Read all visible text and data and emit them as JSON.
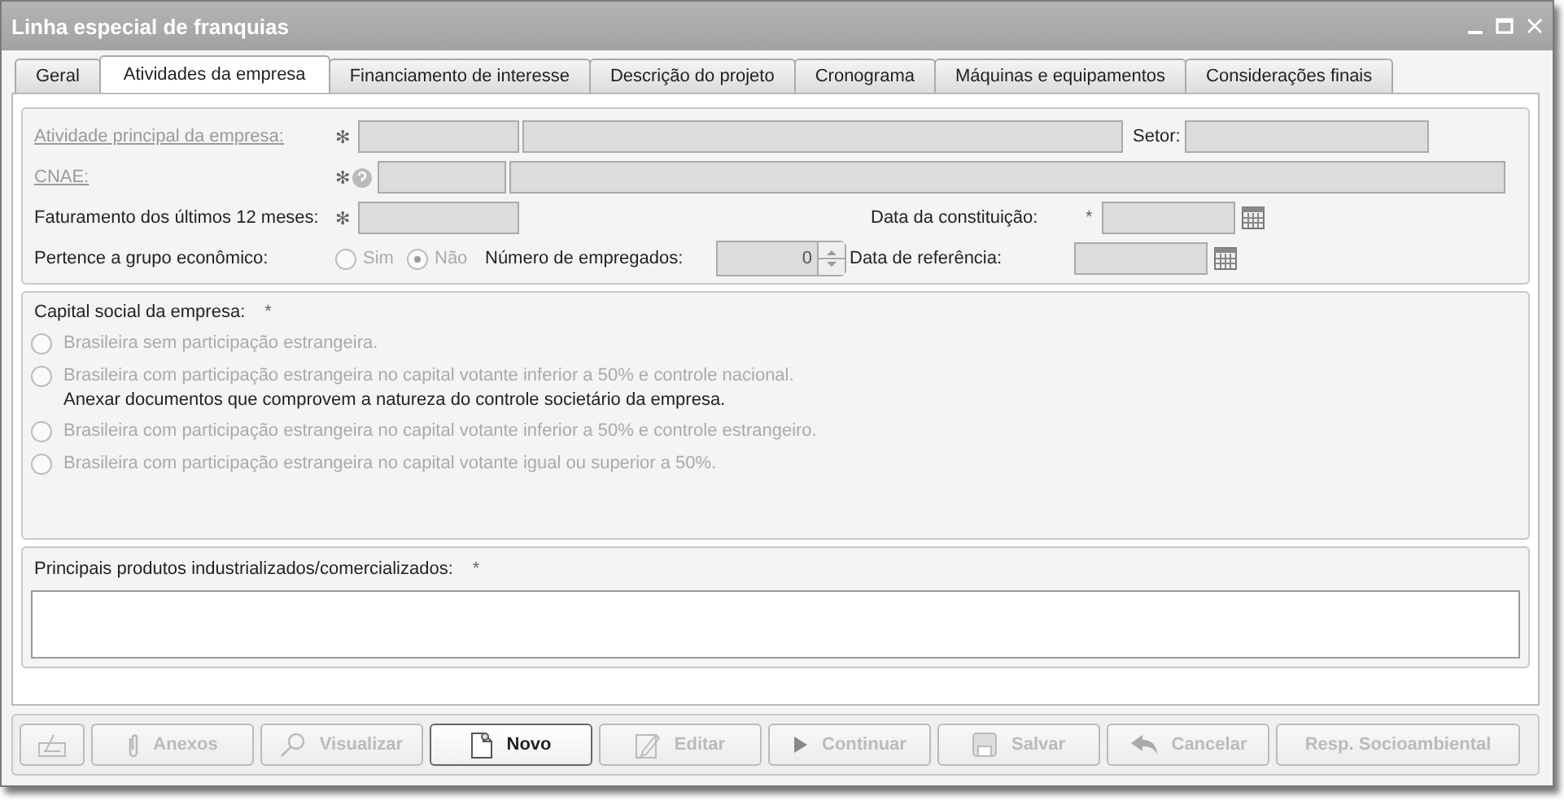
{
  "window": {
    "title": "Linha especial de franquias"
  },
  "tabs": [
    {
      "label": "Geral",
      "selected": false
    },
    {
      "label": "Atividades da empresa",
      "selected": true
    },
    {
      "label": "Financiamento de interesse",
      "selected": false
    },
    {
      "label": "Descrição do projeto",
      "selected": false
    },
    {
      "label": "Cronograma",
      "selected": false
    },
    {
      "label": "Máquinas e equipamentos",
      "selected": false
    },
    {
      "label": "Considerações finais",
      "selected": false
    }
  ],
  "company_rows": [
    [
      {
        "kind": "link",
        "text": "Atividade principal da empresa:"
      },
      {
        "kind": "required",
        "text": "✻"
      },
      {
        "kind": "input"
      },
      {
        "kind": "input"
      },
      {
        "kind": "label",
        "text": "Setor:"
      },
      {
        "kind": "input"
      }
    ],
    [
      {
        "kind": "link",
        "text": "CNAE:"
      },
      {
        "kind": "required",
        "text": "✻"
      },
      {
        "kind": "help"
      },
      {
        "kind": "input"
      },
      {
        "kind": "input"
      }
    ],
    [
      {
        "kind": "label",
        "text": "Faturamento dos últimos 12 meses:"
      },
      {
        "kind": "required",
        "text": "✻"
      },
      {
        "kind": "input"
      },
      {
        "kind": "label",
        "text": "Data da constituição:"
      },
      {
        "kind": "required",
        "text": "*"
      },
      {
        "kind": "date"
      }
    ],
    [
      {
        "kind": "label",
        "text": "Pertence a grupo econômico:"
      },
      {
        "kind": "radio",
        "text": "Sim",
        "selected": false
      },
      {
        "kind": "radio",
        "text": "Não",
        "selected": true
      },
      {
        "kind": "label",
        "text": "Número de empregados:"
      },
      {
        "kind": "spinner",
        "value": "0"
      },
      {
        "kind": "label",
        "text": "Data de referência:"
      },
      {
        "kind": "date"
      }
    ]
  ],
  "capital": {
    "title": "Capital social da empresa:",
    "required": "*",
    "options": [
      {
        "label": "Brasileira sem participação estrangeira.",
        "selected": false
      },
      {
        "label": "Brasileira com participação estrangeira no capital votante inferior a 50% e controle nacional.",
        "selected": false,
        "note": "Anexar documentos que comprovem a natureza do controle societário da empresa."
      },
      {
        "label": "Brasileira com participação estrangeira no capital votante inferior a 50% e controle estrangeiro.",
        "selected": false
      },
      {
        "label": "Brasileira com participação estrangeira no capital votante igual ou superior a 50%.",
        "selected": false
      }
    ]
  },
  "products": {
    "title": "Principais produtos industrializados/comercializados:",
    "required": "*"
  },
  "buttons": [
    {
      "kind": "sign",
      "disabled": true
    },
    {
      "kind": "clip",
      "label": "Anexos",
      "disabled": true
    },
    {
      "kind": "magnifier",
      "label": "Visualizar",
      "disabled": true
    },
    {
      "kind": "new",
      "label": "Novo",
      "disabled": false
    },
    {
      "kind": "pencil",
      "label": "Editar",
      "disabled": true
    },
    {
      "kind": "play",
      "label": "Continuar",
      "disabled": true
    },
    {
      "kind": "save",
      "label": "Salvar",
      "disabled": true
    },
    {
      "kind": "undo",
      "label": "Cancelar",
      "disabled": true
    },
    {
      "kind": "text",
      "label": "Resp. Socioambiental",
      "disabled": true
    }
  ]
}
